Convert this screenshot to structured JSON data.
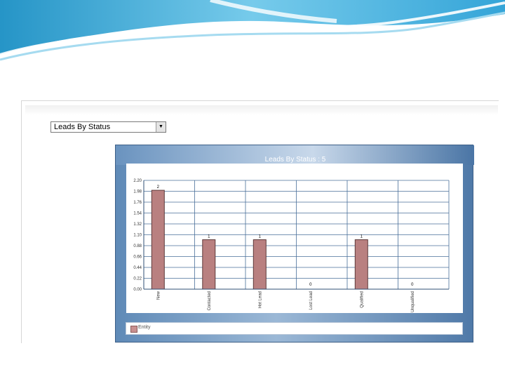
{
  "dropdown": {
    "selected": "Leads By Status"
  },
  "chart_data": {
    "type": "bar",
    "title": "Leads By Status : 5",
    "categories": [
      "New",
      "Contacted",
      "Hot Lead",
      "Lost Lead",
      "Qualified",
      "Unqualified"
    ],
    "series": [
      {
        "name": "Entity",
        "values": [
          2,
          1,
          1,
          0,
          1,
          0
        ]
      }
    ],
    "data_labels": [
      "2",
      "1",
      "1",
      "0",
      "1",
      "0"
    ],
    "y_ticks": [
      "0.00",
      "0.22",
      "0.44",
      "0.66",
      "0.88",
      "1.10",
      "1.32",
      "1.54",
      "1.76",
      "1.98",
      "2.20"
    ],
    "ylim": [
      0,
      2.2
    ],
    "grid": true,
    "legend": "bottom-left",
    "colors": {
      "bar": "#b98080",
      "grid": "#4a6f9a",
      "frame": "#5f8ab7"
    }
  }
}
